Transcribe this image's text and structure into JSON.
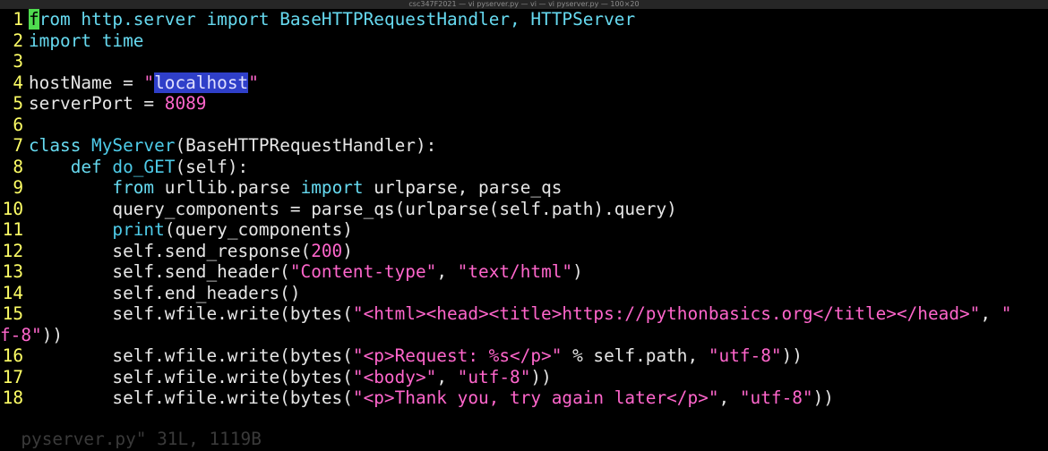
{
  "window": {
    "title": "csc347F2021 — vi pyserver.py — vi — vi pyserver.py — 100×20"
  },
  "lines": [
    {
      "num": "1",
      "tokens": [
        {
          "t": "f",
          "c": "cursor"
        },
        {
          "t": "rom http.server ",
          "c": "kw"
        },
        {
          "t": "import",
          "c": "kw"
        },
        {
          "t": " BaseHTTPRequestHandler, HTTPServer",
          "c": "kw"
        }
      ]
    },
    {
      "num": "2",
      "tokens": [
        {
          "t": "import",
          "c": "kw"
        },
        {
          "t": " time",
          "c": "kw"
        }
      ]
    },
    {
      "num": "3",
      "tokens": []
    },
    {
      "num": "4",
      "tokens": [
        {
          "t": "hostName = ",
          "c": ""
        },
        {
          "t": "\"",
          "c": "str"
        },
        {
          "t": "localhost",
          "c": "sel"
        },
        {
          "t": "\"",
          "c": "str"
        }
      ]
    },
    {
      "num": "5",
      "tokens": [
        {
          "t": "serverPort = ",
          "c": ""
        },
        {
          "t": "8089",
          "c": "num"
        }
      ]
    },
    {
      "num": "6",
      "tokens": []
    },
    {
      "num": "7",
      "tokens": [
        {
          "t": "class ",
          "c": "kw"
        },
        {
          "t": "MyServer",
          "c": "fn"
        },
        {
          "t": "(BaseHTTPRequestHandler):",
          "c": ""
        }
      ]
    },
    {
      "num": "8",
      "tokens": [
        {
          "t": "    ",
          "c": ""
        },
        {
          "t": "def ",
          "c": "kw"
        },
        {
          "t": "do_GET",
          "c": "fn"
        },
        {
          "t": "(self):",
          "c": ""
        }
      ]
    },
    {
      "num": "9",
      "tokens": [
        {
          "t": "        ",
          "c": ""
        },
        {
          "t": "from",
          "c": "kw"
        },
        {
          "t": " urllib.parse ",
          "c": ""
        },
        {
          "t": "import",
          "c": "kw"
        },
        {
          "t": " urlparse, parse_qs",
          "c": ""
        }
      ]
    },
    {
      "num": "10",
      "tokens": [
        {
          "t": "        query_components = parse_qs(urlparse(self.path).query)",
          "c": ""
        }
      ]
    },
    {
      "num": "11",
      "tokens": [
        {
          "t": "        ",
          "c": ""
        },
        {
          "t": "print",
          "c": "fn"
        },
        {
          "t": "(query_components)",
          "c": ""
        }
      ]
    },
    {
      "num": "12",
      "tokens": [
        {
          "t": "        self.send_response(",
          "c": ""
        },
        {
          "t": "200",
          "c": "num"
        },
        {
          "t": ")",
          "c": ""
        }
      ]
    },
    {
      "num": "13",
      "tokens": [
        {
          "t": "        self.send_header(",
          "c": ""
        },
        {
          "t": "\"Content-type\"",
          "c": "str"
        },
        {
          "t": ", ",
          "c": ""
        },
        {
          "t": "\"text/html\"",
          "c": "str"
        },
        {
          "t": ")",
          "c": ""
        }
      ]
    },
    {
      "num": "14",
      "tokens": [
        {
          "t": "        self.end_headers()",
          "c": ""
        }
      ]
    },
    {
      "num": "15",
      "tokens": [
        {
          "t": "        self.wfile.write(bytes(",
          "c": ""
        },
        {
          "t": "\"<html><head><title>https://pythonbasics.org</title></head>\"",
          "c": "str"
        },
        {
          "t": ", ",
          "c": ""
        },
        {
          "t": "\"",
          "c": "str"
        }
      ]
    },
    {
      "num": "",
      "tokens": [
        {
          "t": "f-8\"",
          "c": "str"
        },
        {
          "t": "))",
          "c": ""
        }
      ]
    },
    {
      "num": "16",
      "tokens": [
        {
          "t": "        self.wfile.write(bytes(",
          "c": ""
        },
        {
          "t": "\"<p>Request: %s</p>\"",
          "c": "str"
        },
        {
          "t": " % self.path, ",
          "c": ""
        },
        {
          "t": "\"utf-8\"",
          "c": "str"
        },
        {
          "t": "))",
          "c": ""
        }
      ]
    },
    {
      "num": "17",
      "tokens": [
        {
          "t": "        self.wfile.write(bytes(",
          "c": ""
        },
        {
          "t": "\"<body>\"",
          "c": "str"
        },
        {
          "t": ", ",
          "c": ""
        },
        {
          "t": "\"utf-8\"",
          "c": "str"
        },
        {
          "t": "))",
          "c": ""
        }
      ]
    },
    {
      "num": "18",
      "tokens": [
        {
          "t": "        self.wfile.write(bytes(",
          "c": ""
        },
        {
          "t": "\"<p>Thank you, try again later</p>\"",
          "c": "str"
        },
        {
          "t": ", ",
          "c": ""
        },
        {
          "t": "\"utf-8\"",
          "c": "str"
        },
        {
          "t": "))",
          "c": ""
        }
      ]
    }
  ],
  "status": {
    "text": "pyserver.py\" 31L, 1119B"
  },
  "colors": {
    "background": "#000000",
    "line_number": "#ffff66",
    "keyword": "#66d9ef",
    "string": "#ff66cc",
    "selection": "#2f3fc9",
    "cursor": "#4fdc4f"
  }
}
